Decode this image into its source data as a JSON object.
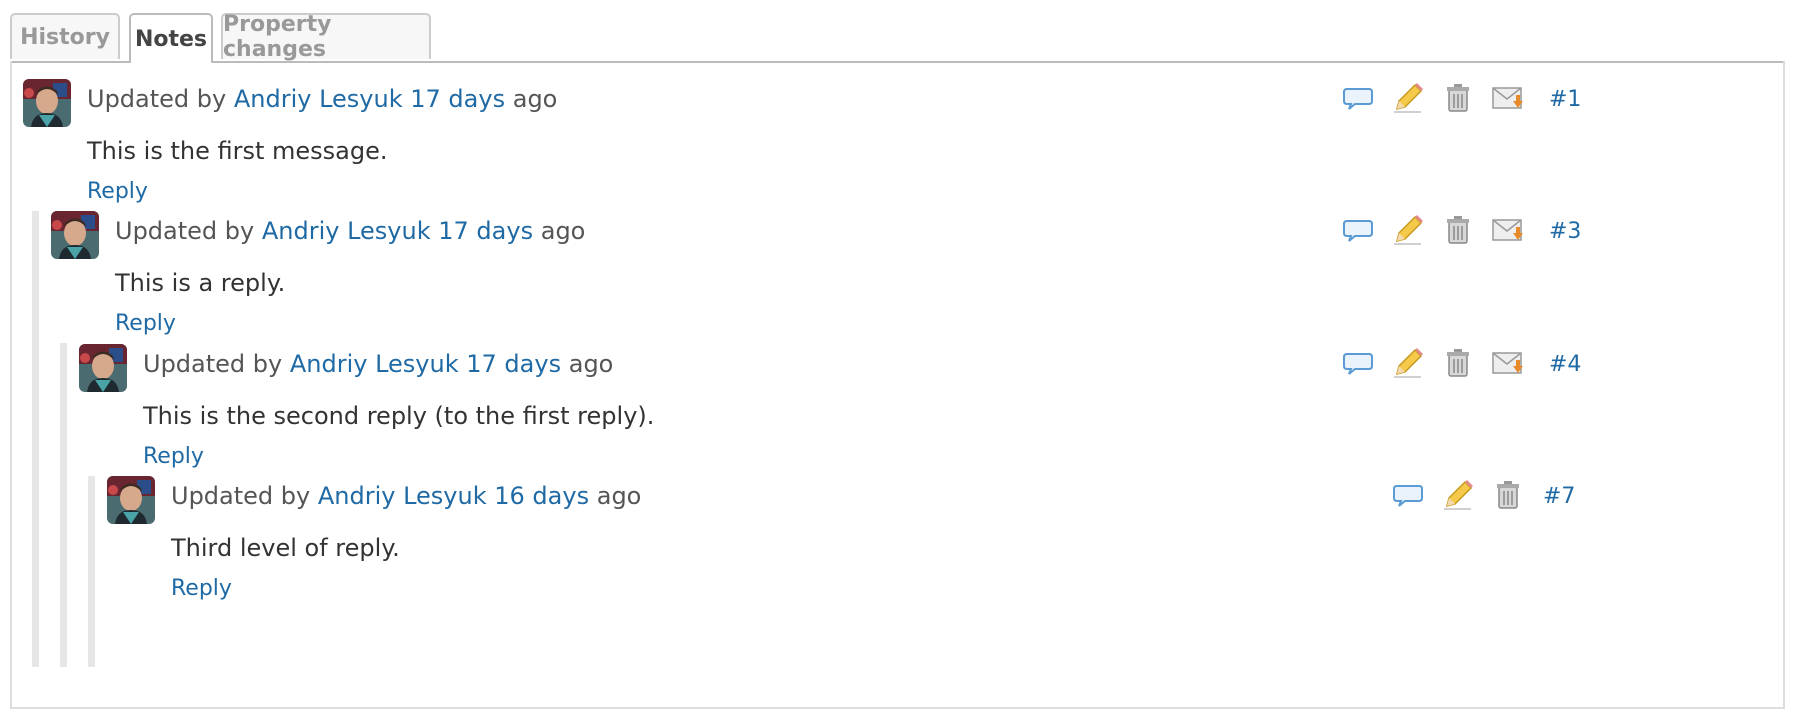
{
  "tabs": [
    {
      "label": "History",
      "active": false
    },
    {
      "label": "Notes",
      "active": true
    },
    {
      "label": "Property changes",
      "active": false
    }
  ],
  "notes": [
    {
      "prefix": "Updated by",
      "author": "Andriy Lesyuk",
      "age": "17 days",
      "suffix": "ago",
      "text": "This is the first message.",
      "reply_label": "Reply",
      "number": "#1"
    },
    {
      "prefix": "Updated by",
      "author": "Andriy Lesyuk",
      "age": "17 days",
      "suffix": "ago",
      "text": "This is a reply.",
      "reply_label": "Reply",
      "number": "#3"
    },
    {
      "prefix": "Updated by",
      "author": "Andriy Lesyuk",
      "age": "17 days",
      "suffix": "ago",
      "text": "This is the second reply (to the first reply).",
      "reply_label": "Reply",
      "number": "#4"
    },
    {
      "prefix": "Updated by",
      "author": "Andriy Lesyuk",
      "age": "16 days",
      "suffix": "ago",
      "text": "Third level of reply.",
      "reply_label": "Reply",
      "number": "#7"
    }
  ],
  "icons": {
    "quote": "speech-bubble-icon",
    "edit": "pencil-icon",
    "delete": "trash-icon",
    "email": "email-icon"
  },
  "colors": {
    "link": "#1f6aa5",
    "tab_border": "#cccccc",
    "thread_bar": "#e6e6e6"
  }
}
